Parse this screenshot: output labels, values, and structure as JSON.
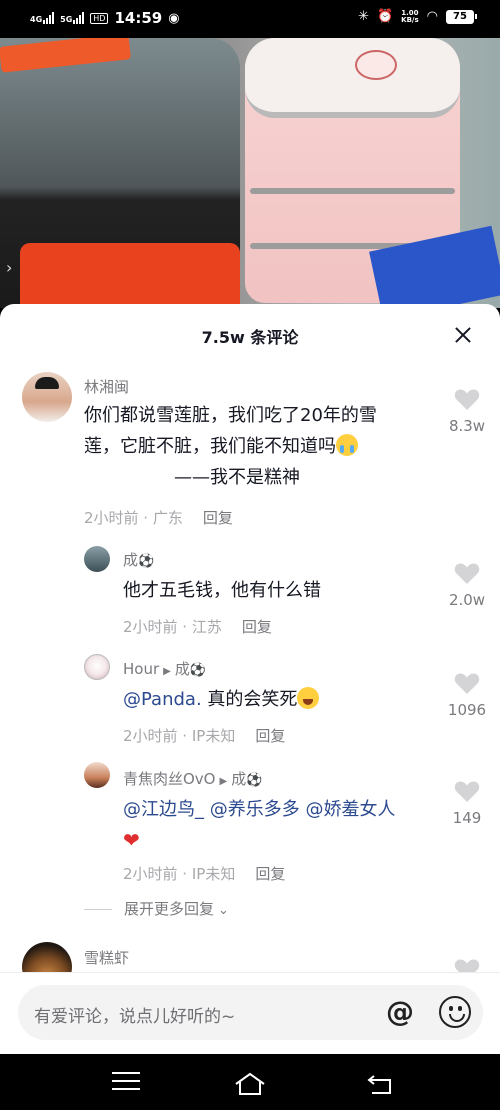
{
  "status_bar": {
    "net1": "4G",
    "net2": "5G",
    "hd": "HD",
    "time": "14:59",
    "net_speed_value": "1.00",
    "net_speed_unit": "KB/s",
    "battery": "75",
    "icons": [
      "signal-icon",
      "signal-icon",
      "hd-icon",
      "compass-icon",
      "bluetooth-icon",
      "alarm-icon",
      "wifi-icon",
      "battery-icon"
    ]
  },
  "sheet": {
    "title": "7.5w 条评论"
  },
  "comments": [
    {
      "author": "林湘闽",
      "text_line1": "你们都说雪莲脏，我们吃了20年的雪",
      "text_line2": "莲，它脏不脏，我们能不知道吗",
      "text_line3": "——我不是糕神",
      "time": "2小时前 · 广东",
      "reply": "回复",
      "likes": "8.3w"
    },
    {
      "author": "成",
      "text": "他才五毛钱，他有什么错",
      "time": "2小时前 · 江苏",
      "reply": "回复",
      "likes": "2.0w"
    },
    {
      "author": "Hour",
      "reply_to": "成",
      "mention": "@Panda.",
      "text": " 真的会笑死",
      "time": "2小时前 · IP未知",
      "reply": "回复",
      "likes": "1096"
    },
    {
      "author": "青焦肉丝OvO",
      "reply_to": "成",
      "mentions": "@江边鸟_ @养乐多多 @娇羞女人",
      "time": "2小时前 · IP未知",
      "reply": "回复",
      "likes": "149"
    },
    {
      "author": "雪糕虾"
    }
  ],
  "expand_more": "展开更多回复",
  "input": {
    "placeholder": "有爱评论，说点儿好听的~",
    "at_label": "@"
  }
}
